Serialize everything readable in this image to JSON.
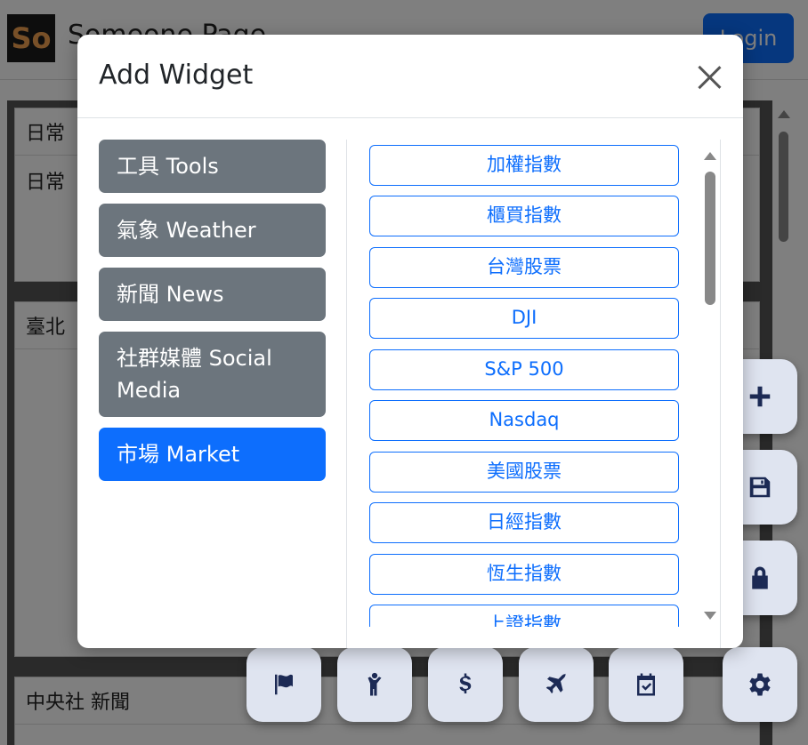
{
  "navbar": {
    "logo_text": "So",
    "site_title": "Someone Page",
    "login_label": "Login"
  },
  "background": {
    "card1_header": "日常",
    "card1_body": "日常",
    "card2_header": "臺北",
    "card3_header": "中央社 新聞"
  },
  "modal": {
    "title": "Add Widget",
    "categories": [
      {
        "label": "工具 Tools",
        "active": false
      },
      {
        "label": "氣象 Weather",
        "active": false
      },
      {
        "label": "新聞 News",
        "active": false
      },
      {
        "label": "社群媒體 Social Media",
        "active": false
      },
      {
        "label": "市場 Market",
        "active": true
      }
    ],
    "widgets": [
      "加權指數",
      "櫃買指數",
      "台灣股票",
      "DJI",
      "S&P 500",
      "Nasdaq",
      "美國股票",
      "日經指數",
      "恆生指數",
      "上證指數"
    ]
  },
  "fabs": {
    "right": [
      "plus-icon",
      "save-icon",
      "lock-icon",
      "gear-icon"
    ],
    "bottom": [
      "flag-icon",
      "child-icon",
      "dollar-icon",
      "plane-icon",
      "calendar-check-icon"
    ]
  },
  "colors": {
    "primary": "#0d6efd",
    "secondary": "#6c757d",
    "fab_bg": "#dfe4f0",
    "fab_icon": "#1c2a55"
  }
}
